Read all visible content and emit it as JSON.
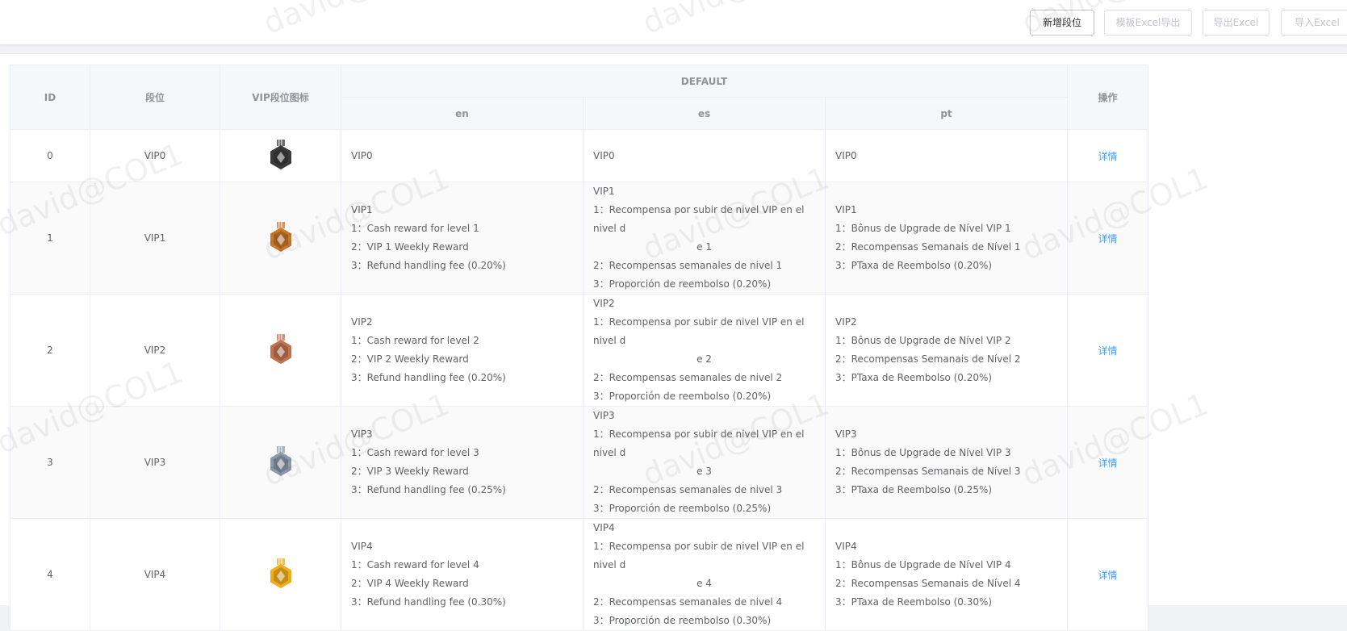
{
  "toolbar": {
    "add_label": "新增段位",
    "template_export_label": "模板Excel导出",
    "export_label": "导出Excel",
    "import_label": "导入Excel"
  },
  "table": {
    "headers": {
      "id": "ID",
      "level": "段位",
      "icon": "VIP段位图标",
      "group": "DEFAULT",
      "en": "en",
      "es": "es",
      "pt": "pt",
      "action": "操作"
    },
    "action_label": "详情",
    "rows": [
      {
        "id": "0",
        "level": "VIP0",
        "badge": "gray-hexagon-medal-icon",
        "badge_color": "#3a3a3a",
        "en": [
          "VIP0"
        ],
        "es": [
          "VIP0"
        ],
        "pt": [
          "VIP0"
        ]
      },
      {
        "id": "1",
        "level": "VIP1",
        "badge": "orange-hexagon-medal-icon",
        "badge_color": "#c9772b",
        "en": [
          "VIP1",
          "1：Cash reward for level 1",
          "2：VIP 1 Weekly Reward",
          "3：Refund handling fee (0.20%)"
        ],
        "es": [
          "VIP1",
          "1：Recompensa por subir de nivel VIP en el nivel d",
          "e 1",
          "2：Recompensas semanales de nivel 1",
          "3：Proporción de reembolso (0.20%)"
        ],
        "pt": [
          "VIP1",
          "1：Bônus de Upgrade de Nível VIP 1",
          "2：Recompensas Semanais de Nível 1",
          "3：PTaxa de Reembolso (0.20%)"
        ]
      },
      {
        "id": "2",
        "level": "VIP2",
        "badge": "copper-hexagon-medal-icon",
        "badge_color": "#c0714e",
        "en": [
          "VIP2",
          "1：Cash reward for level 2",
          "2：VIP 2 Weekly Reward",
          "3：Refund handling fee (0.20%)"
        ],
        "es": [
          "VIP2",
          "1：Recompensa por subir de nivel VIP en el nivel d",
          "e 2",
          "2：Recompensas semanales de nivel 2",
          "3：Proporción de reembolso (0.20%)"
        ],
        "pt": [
          "VIP2",
          "1：Bônus de Upgrade de Nível VIP 2",
          "2：Recompensas Semanais de Nível 2",
          "3：PTaxa de Reembolso (0.20%)"
        ]
      },
      {
        "id": "3",
        "level": "VIP3",
        "badge": "silver-hexagon-medal-icon",
        "badge_color": "#8d9aab",
        "en": [
          "VIP3",
          "1：Cash reward for level 3",
          "2：VIP 3 Weekly Reward",
          "3：Refund handling fee (0.25%)"
        ],
        "es": [
          "VIP3",
          "1：Recompensa por subir de nivel VIP en el nivel d",
          "e 3",
          "2：Recompensas semanales de nivel 3",
          "3：Proporción de reembolso (0.25%)"
        ],
        "pt": [
          "VIP3",
          "1：Bônus de Upgrade de Nível VIP 3",
          "2：Recompensas Semanais de Nível 3",
          "3：PTaxa de Reembolso (0.25%)"
        ]
      },
      {
        "id": "4",
        "level": "VIP4",
        "badge": "gold-hexagon-medal-icon",
        "badge_color": "#f0ad1a",
        "en": [
          "VIP4",
          "1：Cash reward for level 4",
          "2：VIP 4 Weekly Reward",
          "3：Refund handling fee (0.30%)"
        ],
        "es": [
          "VIP4",
          "1：Recompensa por subir de nivel VIP en el nivel d",
          "e 4",
          "2：Recompensas semanales de nivel 4",
          "3：Proporción de reembolso (0.30%)"
        ],
        "pt": [
          "VIP4",
          "1：Bônus de Upgrade de Nível VIP 4",
          "2：Recompensas Semanais de Nível 4",
          "3：PTaxa de Reembolso (0.30%)"
        ]
      }
    ]
  },
  "watermark": "david@COL1",
  "colors": {
    "link": "#409eff",
    "header_bg": "#f5f7fa",
    "border": "#ebeef5"
  }
}
